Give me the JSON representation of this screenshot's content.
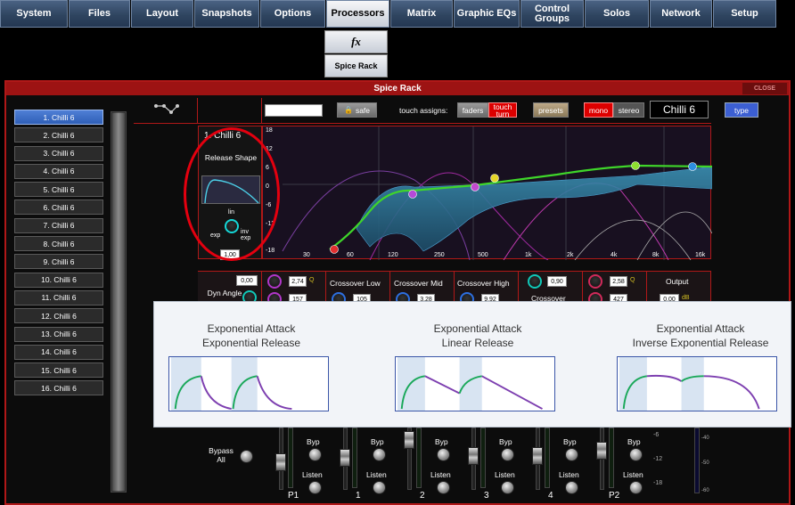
{
  "menu": [
    {
      "label": "System",
      "w": 0
    },
    {
      "label": "Files"
    },
    {
      "label": "Layout"
    },
    {
      "label": "Snapshots"
    },
    {
      "label": "Options"
    },
    {
      "label": "Processors"
    },
    {
      "label": "Matrix"
    },
    {
      "label": "Graphic EQs"
    },
    {
      "label": "Control Groups"
    },
    {
      "label": "Solos"
    },
    {
      "label": "Network"
    },
    {
      "label": "Setup"
    }
  ],
  "submenu": {
    "fx_label": "fx",
    "spice_rack": "Spice Rack"
  },
  "panel": {
    "title": "Spice Rack",
    "close": "CLOSE"
  },
  "channels": [
    "1. Chilli 6",
    "2. Chilli 6",
    "3. Chilli 6",
    "4. Chilli 6",
    "5. Chilli 6",
    "6. Chilli 6",
    "7. Chilli 6",
    "8. Chilli 6",
    "9. Chilli 6",
    "10. Chilli 6",
    "11. Chilli 6",
    "12. Chilli 6",
    "13. Chilli 6",
    "14. Chilli 6",
    "15. Chilli 6",
    "16. Chilli 6"
  ],
  "header": {
    "safe": "safe",
    "touch_assigns": "touch assigns:",
    "faders": "faders",
    "touch_turn": "touch turn",
    "presets": "presets",
    "mono": "mono",
    "stereo": "stereo",
    "plugin_name": "Chilli 6",
    "type": "type"
  },
  "release": {
    "title": "1. Chilli 6",
    "shape_label": "Release Shape",
    "lin": "lin",
    "exp": "exp",
    "inv_exp": "inv exp",
    "value": "1,00"
  },
  "graph": {
    "y_ticks": [
      "18",
      "12",
      "6",
      "0",
      "-6",
      "-12",
      "-18"
    ],
    "x_ticks": [
      "30",
      "60",
      "120",
      "250",
      "500",
      "1k",
      "2k",
      "4k",
      "8k",
      "16k"
    ]
  },
  "strip": {
    "dyn_angle": "Dyn Angle",
    "val_0": "0,00",
    "val_274": "2,74",
    "q": "Q",
    "val_157": "157",
    "crossover_low": "Crossover Low",
    "val_105": "105",
    "crossover_mid": "Crossover Mid",
    "val_328": "3,28",
    "crossover_high": "Crossover High",
    "val_992": "9,92",
    "val_090": "0,90",
    "crossover": "Crossover",
    "val_258": "2,58",
    "q2": "Q",
    "val_427": "427",
    "output": "Output",
    "out_val": "0,00",
    "db": "dB"
  },
  "overlay": {
    "col1": {
      "line1": "Exponential Attack",
      "line2": "Exponential Release"
    },
    "col2": {
      "line1": "Exponential Attack",
      "line2": "Linear Release"
    },
    "col3": {
      "line1": "Exponential Attack",
      "line2": "Inverse Exponential Release"
    }
  },
  "bottom": {
    "bypass_all": "Bypass All",
    "byp": "Byp",
    "listen": "Listen",
    "bands": [
      "P1",
      "1",
      "2",
      "3",
      "4",
      "P2"
    ],
    "meter_ticks": [
      "-6",
      "-12",
      "-18"
    ],
    "meter_ticks2": [
      "-40",
      "-50",
      "-60"
    ]
  },
  "colors": {
    "accent_red": "#b01818",
    "selected_blue": "#3c6ccb",
    "curve_green": "#3fd62a",
    "fill_teal": "#2e6e8e"
  }
}
